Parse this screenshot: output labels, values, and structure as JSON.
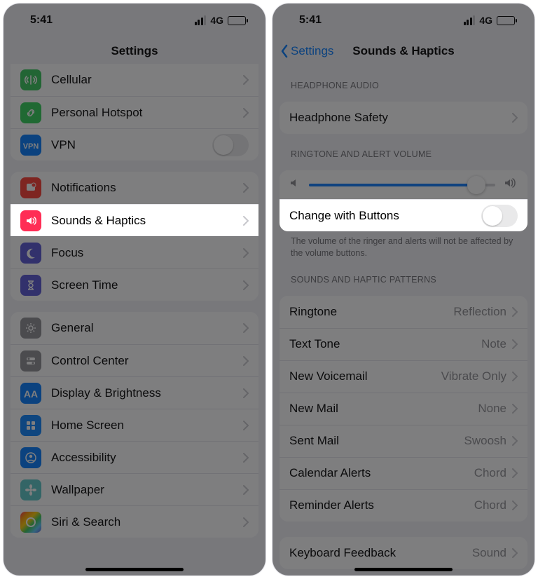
{
  "status": {
    "time": "5:41",
    "network": "4G"
  },
  "left": {
    "title": "Settings",
    "groups": [
      {
        "rows": [
          {
            "id": "cellular",
            "label": "Cellular",
            "icon": "antenna-icon",
            "color": "bg-green"
          },
          {
            "id": "hotspot",
            "label": "Personal Hotspot",
            "icon": "link-icon",
            "color": "bg-green2"
          },
          {
            "id": "vpn",
            "label": "VPN",
            "icon": "vpn-icon",
            "color": "bg-blue",
            "toggle": true
          }
        ]
      },
      {
        "rows": [
          {
            "id": "notifications",
            "label": "Notifications",
            "icon": "bell-icon",
            "color": "bg-red"
          },
          {
            "id": "sounds",
            "label": "Sounds & Haptics",
            "icon": "speaker-icon",
            "color": "bg-pinkred",
            "highlight": true
          },
          {
            "id": "focus",
            "label": "Focus",
            "icon": "moon-icon",
            "color": "bg-indigo"
          },
          {
            "id": "screentime",
            "label": "Screen Time",
            "icon": "hourglass-icon",
            "color": "bg-indigo"
          }
        ]
      },
      {
        "rows": [
          {
            "id": "general",
            "label": "General",
            "icon": "gear-icon",
            "color": "bg-gray"
          },
          {
            "id": "controlcenter",
            "label": "Control Center",
            "icon": "switches-icon",
            "color": "bg-gray"
          },
          {
            "id": "display",
            "label": "Display & Brightness",
            "icon": "aa-icon",
            "color": "bg-blue"
          },
          {
            "id": "homescreen",
            "label": "Home Screen",
            "icon": "grid-icon",
            "color": "bg-bluept"
          },
          {
            "id": "accessibility",
            "label": "Accessibility",
            "icon": "person-icon",
            "color": "bg-blue"
          },
          {
            "id": "wallpaper",
            "label": "Wallpaper",
            "icon": "flower-icon",
            "color": "bg-teal"
          },
          {
            "id": "siri",
            "label": "Siri & Search",
            "icon": "siri-icon",
            "color": "bg-multi"
          }
        ]
      }
    ]
  },
  "right": {
    "back": "Settings",
    "title": "Sounds & Haptics",
    "headphone_header": "HEADPHONE AUDIO",
    "headphone_row": "Headphone Safety",
    "ringtone_header": "RINGTONE AND ALERT VOLUME",
    "change_buttons": "Change with Buttons",
    "change_note": "The volume of the ringer and alerts will not be affected by the volume buttons.",
    "patterns_header": "SOUNDS AND HAPTIC PATTERNS",
    "patterns": [
      {
        "label": "Ringtone",
        "value": "Reflection"
      },
      {
        "label": "Text Tone",
        "value": "Note"
      },
      {
        "label": "New Voicemail",
        "value": "Vibrate Only"
      },
      {
        "label": "New Mail",
        "value": "None"
      },
      {
        "label": "Sent Mail",
        "value": "Swoosh"
      },
      {
        "label": "Calendar Alerts",
        "value": "Chord"
      },
      {
        "label": "Reminder Alerts",
        "value": "Chord"
      }
    ],
    "keyboard_row": {
      "label": "Keyboard Feedback",
      "value": "Sound"
    }
  }
}
